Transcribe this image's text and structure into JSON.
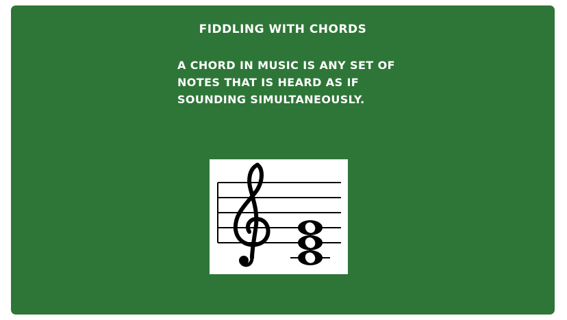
{
  "slide": {
    "title": "Fiddling with Chords",
    "description_lines": [
      "A chord in music is any set of",
      "notes that is heard as if",
      "sounding simultaneously."
    ]
  },
  "figure": {
    "icon": "treble-clef-chord-icon",
    "staff_lines": 5,
    "notes": [
      "C",
      "E",
      "G"
    ]
  },
  "colors": {
    "board": "#2e7638",
    "text": "#ffffff",
    "figure_bg": "#ffffff",
    "ink": "#000000"
  }
}
